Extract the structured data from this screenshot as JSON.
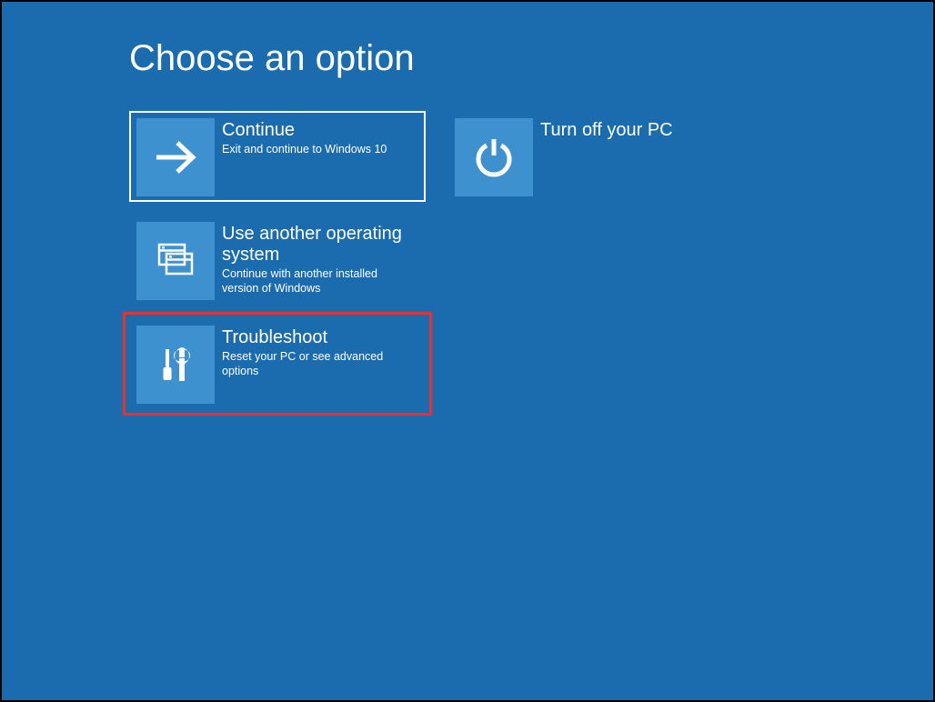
{
  "title": "Choose an option",
  "options": {
    "continue": {
      "title": "Continue",
      "subtitle": "Exit and continue to Windows 10"
    },
    "useAnother": {
      "title": "Use another operating system",
      "subtitle": "Continue with another installed version of Windows"
    },
    "troubleshoot": {
      "title": "Troubleshoot",
      "subtitle": "Reset your PC or see advanced options"
    },
    "turnOff": {
      "title": "Turn off your PC",
      "subtitle": ""
    }
  }
}
